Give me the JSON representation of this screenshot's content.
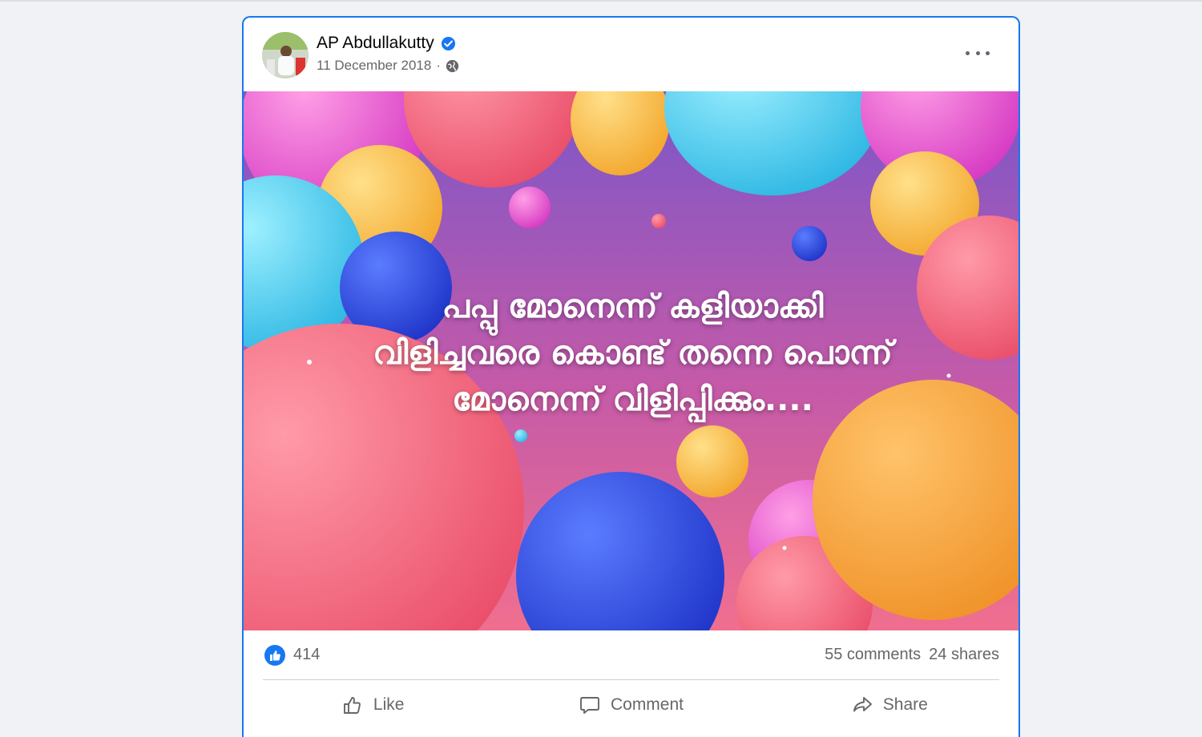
{
  "post": {
    "author": "AP Abdullakutty",
    "date": "11 December 2018",
    "separator": "·",
    "privacy_icon": "globe-icon",
    "verified_icon": "verified-badge-icon",
    "more_icon": "more-options-icon",
    "image_caption_lines": [
      "പപ്പു മോനെന്ന് കളിയാക്കി",
      "വിളിച്ചവരെ കൊണ്ട് തന്നെ പൊന്ന്",
      "മോനെന്ന് വിളിപ്പിക്കും...."
    ]
  },
  "stats": {
    "reaction_icon": "like-reaction-icon",
    "reaction_count": "414",
    "comments": "55 comments",
    "shares": "24 shares"
  },
  "actions": {
    "like": "Like",
    "comment": "Comment",
    "share": "Share"
  },
  "colors": {
    "brand": "#1877f2",
    "text_secondary": "#65676b",
    "page_bg": "#f0f2f5"
  }
}
